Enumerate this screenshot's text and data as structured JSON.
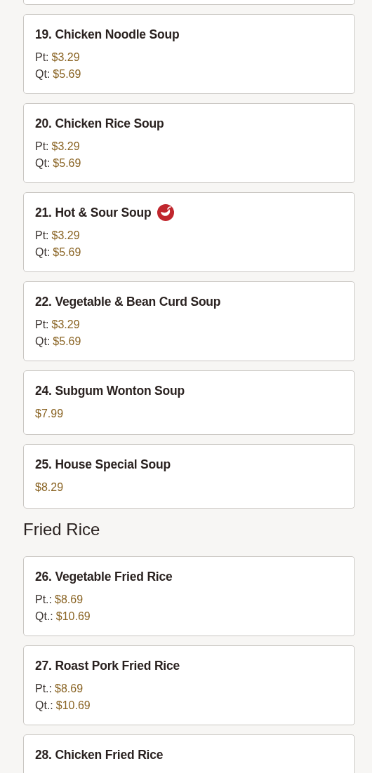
{
  "sections": [
    {
      "items": [
        {
          "name": "19. Chicken Noodle Soup",
          "spicy": false,
          "prices": [
            {
              "label": "Pt:",
              "amount": "$3.29"
            },
            {
              "label": "Qt:",
              "amount": "$5.69"
            }
          ]
        },
        {
          "name": "20. Chicken Rice Soup",
          "spicy": false,
          "prices": [
            {
              "label": "Pt:",
              "amount": "$3.29"
            },
            {
              "label": "Qt:",
              "amount": "$5.69"
            }
          ]
        },
        {
          "name": "21. Hot & Sour Soup",
          "spicy": true,
          "prices": [
            {
              "label": "Pt:",
              "amount": "$3.29"
            },
            {
              "label": "Qt:",
              "amount": "$5.69"
            }
          ]
        },
        {
          "name": "22. Vegetable & Bean Curd Soup",
          "spicy": false,
          "prices": [
            {
              "label": "Pt:",
              "amount": "$3.29"
            },
            {
              "label": "Qt:",
              "amount": "$5.69"
            }
          ]
        },
        {
          "name": "24. Subgum Wonton Soup",
          "spicy": false,
          "prices": [
            {
              "amount": "$7.99"
            }
          ]
        },
        {
          "name": "25. House Special Soup",
          "spicy": false,
          "prices": [
            {
              "amount": "$8.29"
            }
          ]
        }
      ]
    },
    {
      "title": "Fried Rice",
      "items": [
        {
          "name": "26. Vegetable Fried Rice",
          "spicy": false,
          "prices": [
            {
              "label": "Pt.:",
              "amount": "$8.69"
            },
            {
              "label": "Qt.:",
              "amount": "$10.69"
            }
          ]
        },
        {
          "name": "27. Roast Pork Fried Rice",
          "spicy": false,
          "prices": [
            {
              "label": "Pt.:",
              "amount": "$8.69"
            },
            {
              "label": "Qt.:",
              "amount": "$10.69"
            }
          ]
        },
        {
          "name": "28. Chicken Fried Rice",
          "spicy": false
        }
      ]
    }
  ]
}
